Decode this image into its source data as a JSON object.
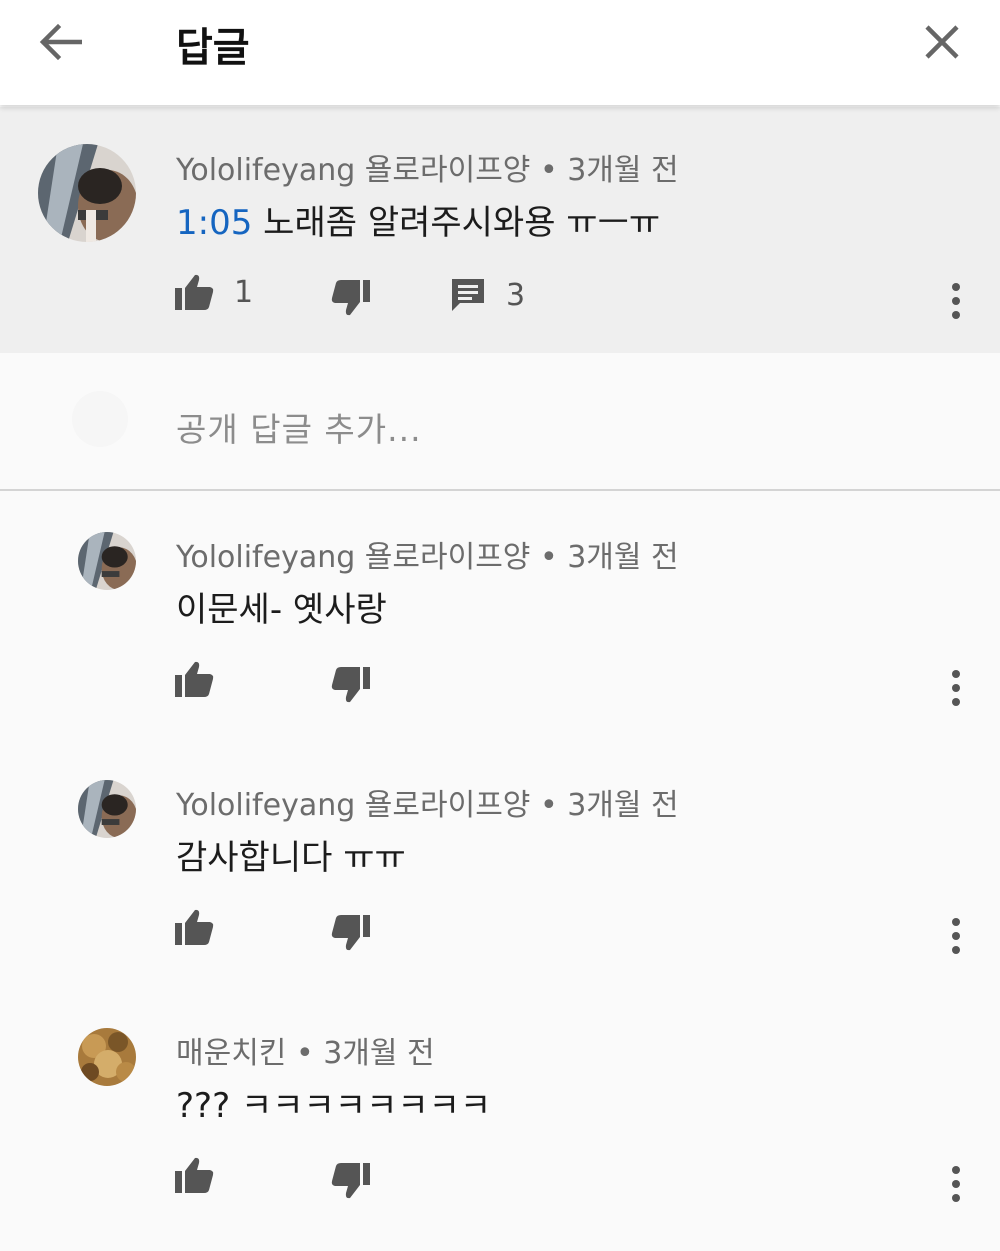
{
  "header": {
    "title": "답글"
  },
  "parent_comment": {
    "author": "Yololifeyang 욜로라이프양",
    "time": "3개월 전",
    "timestamp_link": "1:05",
    "text": " 노래좀 알려주시와용 ㅠㅡㅠ",
    "likes": "1",
    "replies": "3"
  },
  "reply_input": {
    "placeholder": "공개 답글 추가..."
  },
  "replies": [
    {
      "author": "Yololifeyang 욜로라이프양",
      "time": "3개월 전",
      "text": "이문세- 옛사랑"
    },
    {
      "author": "Yololifeyang 욜로라이프양",
      "time": "3개월 전",
      "text": "감사합니다 ㅠㅠ"
    },
    {
      "author": "매운치킨",
      "time": "3개월 전",
      "text": "??? ㅋㅋㅋㅋㅋㅋㅋㅋ"
    }
  ],
  "separator": " • ",
  "colors": {
    "link": "#1565c0",
    "parent_bg": "#efefef",
    "icon": "#555555"
  },
  "icons": [
    "back-arrow-icon",
    "close-icon",
    "thumbs-up-icon",
    "thumbs-down-icon",
    "comment-icon",
    "more-vert-icon"
  ]
}
